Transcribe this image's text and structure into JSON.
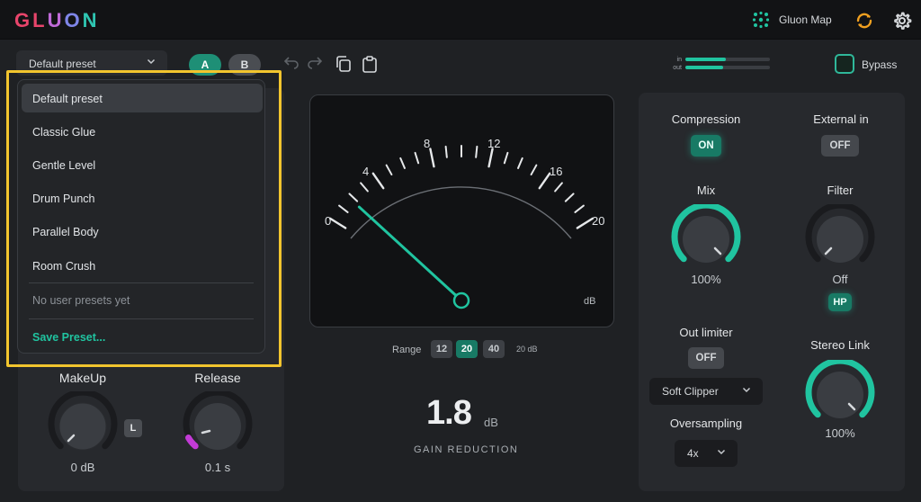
{
  "app": {
    "logo_letters": [
      "G",
      "L",
      "U",
      "O",
      "N"
    ],
    "logo_colors": [
      "#e8456b",
      "#e8456b",
      "#c06ad8",
      "#7f86e8",
      "#2fc6b2"
    ],
    "gluon_map_label": "Gluon Map",
    "icons": {
      "map": "atom-icon",
      "sync": "sync-icon",
      "settings": "gear-icon"
    }
  },
  "toolbar": {
    "preset_value": "Default preset",
    "ab_a": "A",
    "ab_b": "B",
    "meter_in_label": "in",
    "meter_out_label": "out",
    "meter_in_level": 0.48,
    "meter_out_level": 0.45,
    "bypass_label": "Bypass",
    "bypass_checked": false
  },
  "preset_menu": {
    "items": [
      {
        "label": "Default preset",
        "selected": true
      },
      {
        "label": "Classic Glue",
        "selected": false
      },
      {
        "label": "Gentle Level",
        "selected": false
      },
      {
        "label": "Drum Punch",
        "selected": false
      },
      {
        "label": "Parallel Body",
        "selected": false
      },
      {
        "label": "Room Crush",
        "selected": false
      }
    ],
    "empty_user_label": "No user presets yet",
    "save_label": "Save Preset..."
  },
  "left_panel": {
    "makeup": {
      "label": "MakeUp",
      "value": "0 dB",
      "badge": "L",
      "level": 0.0
    },
    "release": {
      "label": "Release",
      "value": "0.1 s",
      "level": 0.05
    }
  },
  "gr_meter": {
    "scale_labels": [
      "0",
      "4",
      "8",
      "12",
      "16",
      "20"
    ],
    "unit": "dB",
    "needle_value_db": 1.8,
    "scale_max_db": 20,
    "range_label": "Range",
    "range_options": [
      "12",
      "20",
      "40"
    ],
    "range_selected": "20",
    "range_note": "20 dB",
    "gain_reduction_value": "1.8",
    "gain_reduction_unit": "dB",
    "gain_reduction_label": "GAIN REDUCTION"
  },
  "right_panel": {
    "compression": {
      "label": "Compression",
      "state": "ON"
    },
    "external_in": {
      "label": "External in",
      "state": "OFF"
    },
    "mix": {
      "label": "Mix",
      "value": "100%",
      "level": 1.0
    },
    "filter": {
      "label": "Filter",
      "value": "Off",
      "mode": "HP",
      "level": 0.0
    },
    "out_limiter": {
      "label": "Out limiter",
      "state": "OFF"
    },
    "clipper_select": "Soft Clipper",
    "oversampling": {
      "label": "Oversampling",
      "value": "4x"
    },
    "stereo_link": {
      "label": "Stereo Link",
      "value": "100%",
      "level": 1.0
    }
  },
  "colors": {
    "accent": "#20c4a0",
    "highlight_border": "#f2c52e",
    "release_accent": "#c23bd6",
    "sync_icon": "#f0a020"
  }
}
